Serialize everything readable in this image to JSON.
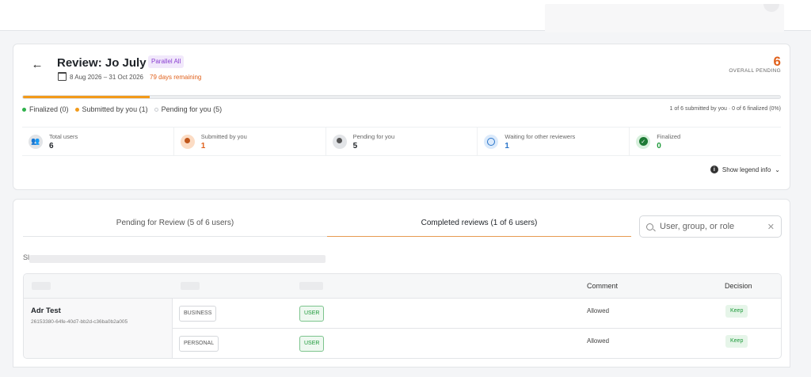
{
  "review": {
    "title": "Review: Jo July 6",
    "badge": "Parallel All",
    "dates": "8 Aug 2026 – 31 Oct 2026",
    "remaining": "79 days remaining",
    "overall_pending_value": "6",
    "overall_pending_label": "OVERALL PENDING",
    "progress_fraction": 0.167
  },
  "legend": {
    "finalized": "Finalized (0)",
    "submitted": "Submitted by you (1)",
    "pending": "Pending for you (5)",
    "summary": "1 of 6 submitted by you · 0 of 6 finalized (0%)",
    "toggle_label": "Show legend info"
  },
  "stats": [
    {
      "label": "Total users",
      "value": "6",
      "icon": "users-icon"
    },
    {
      "label": "Submitted by you",
      "value": "1",
      "icon": "user-icon"
    },
    {
      "label": "Pending for you",
      "value": "5",
      "icon": "user-outline-icon"
    },
    {
      "label": "Waiting for other reviewers",
      "value": "1",
      "icon": "clock-icon"
    },
    {
      "label": "Finalized",
      "value": "0",
      "icon": "check-circle-icon"
    }
  ],
  "tabs": [
    {
      "label": "Pending for Review (5 of 6 users)"
    },
    {
      "label": "Completed reviews (1 of 6 users)"
    }
  ],
  "search": {
    "placeholder": "User, group, or role"
  },
  "showing_prefix": "Sl",
  "table": {
    "headers": {
      "comment": "Comment",
      "decision": "Decision"
    },
    "user": {
      "name": "Adr Test",
      "id": "26153380-64fe-40d7-bb2d-c36ba0b2a005"
    },
    "rows": [
      {
        "type": "BUSINESS",
        "kind": "USER",
        "comment": "Allowed",
        "decision": "Keep"
      },
      {
        "type": "PERSONAL",
        "kind": "USER",
        "comment": "Allowed",
        "decision": "Keep"
      }
    ]
  },
  "colors": {
    "accent": "#e0611c",
    "progress": "#f29a1a",
    "success": "#1d9a3a",
    "info": "#2a74c9",
    "badge": "#8a3fd1"
  }
}
